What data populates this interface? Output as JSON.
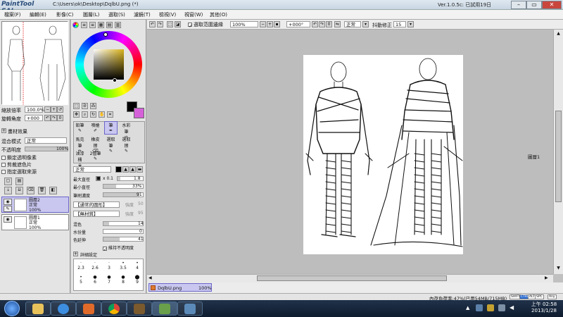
{
  "titlebar": {
    "app_logo": "PaintTool SAI",
    "path": "C:\\Users\\ok\\Desktop\\DqlbU.png (*)",
    "version": "Ver.1.0.5c: 已試用19日"
  },
  "menu": [
    "檔案(F)",
    "編輯(E)",
    "影像(C)",
    "圖層(L)",
    "選取(S)",
    "濾鏡(T)",
    "檢視(V)",
    "視窗(W)",
    "其他(O)"
  ],
  "navigator": {
    "zoom_label": "縮放倍率",
    "zoom_value": "100.0%",
    "rotate_label": "旋轉角度",
    "rotate_value": "+000"
  },
  "layer_panel": {
    "section_title": "畫材效果",
    "blend_label": "混合模式",
    "blend_value": "正常",
    "opacity_label": "不透明度",
    "opacity_value": "100%",
    "options": [
      "鎖定透明像素",
      "剪裁遮色片",
      "指定選取來源"
    ],
    "layers": [
      {
        "name": "圖層2",
        "mode": "正常",
        "opacity": "100%",
        "selected": true
      },
      {
        "name": "圖層1",
        "mode": "正常",
        "opacity": "100%",
        "selected": false
      }
    ]
  },
  "tools": {
    "brush_names": [
      [
        "鉛筆",
        "噴槍",
        "筆",
        "水彩筆"
      ],
      [
        "馬克筆",
        "橡皮擦",
        "選取筆",
        "選取擦"
      ],
      [
        "油漆桶",
        "2值筆",
        "",
        ""
      ]
    ],
    "mode_label": "正常",
    "max_size_label": "最大直徑",
    "max_size_mult": "x 0.1",
    "max_size_value": "1.8",
    "min_size_label": "最小直徑",
    "min_size_value": "33%",
    "density_label": "筆刷濃度",
    "density_value": "91",
    "shape_label": "【通常的圓形】",
    "shape_strength_label": "強度",
    "shape_strength_value": "50",
    "texture_label": "【無材質】",
    "texture_strength_label": "強度",
    "texture_strength_value": "95",
    "blend_label": "混色",
    "blend_value": "14",
    "water_label": "水份量",
    "water_value": "0",
    "persist_label": "色延伸",
    "persist_value": "41",
    "keep_opacity_label": "維持不透明度",
    "detail_label": "詳細設定",
    "size_presets": [
      "2.3",
      "2.6",
      "3",
      "3.5",
      "4",
      "5",
      "6",
      "7",
      "8",
      "9"
    ]
  },
  "topbar": {
    "antialias_label": "選取范圍邊緣",
    "zoom_value": "100%",
    "rotate_value": "+000°",
    "mode_value": "正常",
    "stabilizer_label": "抖動修正",
    "stabilizer_value": "15"
  },
  "canvas": {
    "layer_tooltip": "圖層1"
  },
  "document_tab": {
    "name": "DqlbU.png",
    "zoom": "100%"
  },
  "status": {
    "memory": "內存負荷率:47%(已用54MB/715MB)",
    "indicators": [
      "SHIFT",
      "CTRL",
      "ALT",
      "SPC",
      "Any"
    ]
  },
  "taskbar": {
    "time": "上午 02:58",
    "date": "2013/1/28"
  },
  "colors": {
    "primary": "#000000",
    "secondary": "#d561d9",
    "selection": "#c9c7f0"
  }
}
